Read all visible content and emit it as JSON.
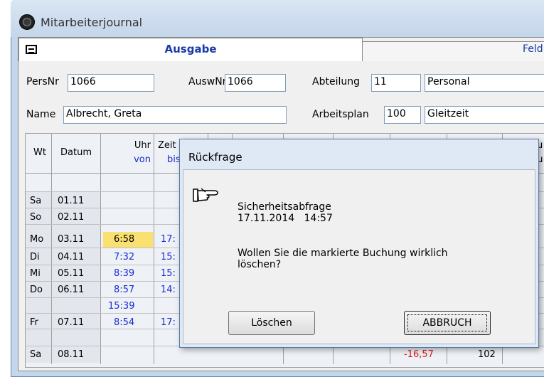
{
  "window": {
    "title": "Mitarbeiterjournal",
    "icon": "clock-app-icon"
  },
  "tabs": [
    {
      "label": "Ausgabe",
      "active": true
    },
    {
      "label": "Feld",
      "active": false
    }
  ],
  "form": {
    "persnr_label": "PersNr",
    "persnr_value": "1066",
    "auswnr_label": "AuswNr",
    "auswnr_value": "1066",
    "abteilung_label": "Abteilung",
    "abteilung_code": "11",
    "abteilung_name": "Personal",
    "name_label": "Name",
    "name_value": "Albrecht, Greta",
    "arbeitsplan_label": "Arbeitsplan",
    "arbeitsplan_code": "100",
    "arbeitsplan_name": "Gleitzeit"
  },
  "table": {
    "headers": {
      "wt": "Wt",
      "datum": "Datum",
      "uhr_top": "Uhr",
      "uhr_bottom": "von",
      "zeit_top": "Zeit",
      "zeit_bottom": "bis",
      "right_top": "au",
      "right_bottom": "bu"
    },
    "rows": [
      {
        "wt": "",
        "datum": "",
        "von": "",
        "bis": ""
      },
      {
        "wt": "Sa",
        "datum": "01.11",
        "von": "",
        "bis": ""
      },
      {
        "wt": "So",
        "datum": "02.11",
        "von": "",
        "bis": ""
      },
      {
        "wt": "Mo",
        "datum": "03.11",
        "von": "6:58",
        "bis": "17:"
      },
      {
        "wt": "Di",
        "datum": "04.11",
        "von": "7:32",
        "bis": "15:"
      },
      {
        "wt": "Mi",
        "datum": "05.11",
        "von": "8:39",
        "bis": "15:"
      },
      {
        "wt": "Do",
        "datum": "06.11",
        "von": "8:57",
        "bis": "14:"
      },
      {
        "wt": "",
        "datum": "",
        "von": "15:39",
        "bis": ""
      },
      {
        "wt": "Fr",
        "datum": "07.11",
        "von": "8:54",
        "bis": "17:"
      },
      {
        "wt": "Sa",
        "datum": "08.11",
        "von": "",
        "bis": "",
        "saldo": "-16,57",
        "count": "102"
      }
    ]
  },
  "dialog": {
    "title": "Rückfrage",
    "heading": "Sicherheitsabfrage",
    "datetime": "17.11.2014   14:57",
    "question_line1": "Wollen Sie die markierte Buchung wirklich",
    "question_line2": "löschen?",
    "delete_label": "Löschen",
    "cancel_label": "ABBRUCH"
  },
  "colors": {
    "accent": "#1a3aa8",
    "highlight": "#f9e070",
    "negative": "#e01818",
    "time_text": "#1a2ed0"
  }
}
